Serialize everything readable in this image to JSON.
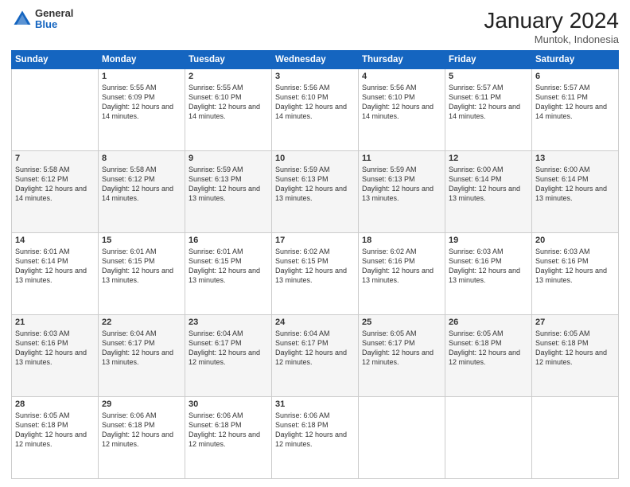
{
  "header": {
    "logo": {
      "line1": "General",
      "line2": "Blue"
    },
    "title": "January 2024",
    "subtitle": "Muntok, Indonesia"
  },
  "days_of_week": [
    "Sunday",
    "Monday",
    "Tuesday",
    "Wednesday",
    "Thursday",
    "Friday",
    "Saturday"
  ],
  "weeks": [
    [
      {
        "day": "",
        "info": ""
      },
      {
        "day": "1",
        "info": "Sunrise: 5:55 AM\nSunset: 6:09 PM\nDaylight: 12 hours\nand 14 minutes."
      },
      {
        "day": "2",
        "info": "Sunrise: 5:55 AM\nSunset: 6:10 PM\nDaylight: 12 hours\nand 14 minutes."
      },
      {
        "day": "3",
        "info": "Sunrise: 5:56 AM\nSunset: 6:10 PM\nDaylight: 12 hours\nand 14 minutes."
      },
      {
        "day": "4",
        "info": "Sunrise: 5:56 AM\nSunset: 6:10 PM\nDaylight: 12 hours\nand 14 minutes."
      },
      {
        "day": "5",
        "info": "Sunrise: 5:57 AM\nSunset: 6:11 PM\nDaylight: 12 hours\nand 14 minutes."
      },
      {
        "day": "6",
        "info": "Sunrise: 5:57 AM\nSunset: 6:11 PM\nDaylight: 12 hours\nand 14 minutes."
      }
    ],
    [
      {
        "day": "7",
        "info": "Sunrise: 5:58 AM\nSunset: 6:12 PM\nDaylight: 12 hours\nand 14 minutes."
      },
      {
        "day": "8",
        "info": "Sunrise: 5:58 AM\nSunset: 6:12 PM\nDaylight: 12 hours\nand 14 minutes."
      },
      {
        "day": "9",
        "info": "Sunrise: 5:59 AM\nSunset: 6:13 PM\nDaylight: 12 hours\nand 13 minutes."
      },
      {
        "day": "10",
        "info": "Sunrise: 5:59 AM\nSunset: 6:13 PM\nDaylight: 12 hours\nand 13 minutes."
      },
      {
        "day": "11",
        "info": "Sunrise: 5:59 AM\nSunset: 6:13 PM\nDaylight: 12 hours\nand 13 minutes."
      },
      {
        "day": "12",
        "info": "Sunrise: 6:00 AM\nSunset: 6:14 PM\nDaylight: 12 hours\nand 13 minutes."
      },
      {
        "day": "13",
        "info": "Sunrise: 6:00 AM\nSunset: 6:14 PM\nDaylight: 12 hours\nand 13 minutes."
      }
    ],
    [
      {
        "day": "14",
        "info": "Sunrise: 6:01 AM\nSunset: 6:14 PM\nDaylight: 12 hours\nand 13 minutes."
      },
      {
        "day": "15",
        "info": "Sunrise: 6:01 AM\nSunset: 6:15 PM\nDaylight: 12 hours\nand 13 minutes."
      },
      {
        "day": "16",
        "info": "Sunrise: 6:01 AM\nSunset: 6:15 PM\nDaylight: 12 hours\nand 13 minutes."
      },
      {
        "day": "17",
        "info": "Sunrise: 6:02 AM\nSunset: 6:15 PM\nDaylight: 12 hours\nand 13 minutes."
      },
      {
        "day": "18",
        "info": "Sunrise: 6:02 AM\nSunset: 6:16 PM\nDaylight: 12 hours\nand 13 minutes."
      },
      {
        "day": "19",
        "info": "Sunrise: 6:03 AM\nSunset: 6:16 PM\nDaylight: 12 hours\nand 13 minutes."
      },
      {
        "day": "20",
        "info": "Sunrise: 6:03 AM\nSunset: 6:16 PM\nDaylight: 12 hours\nand 13 minutes."
      }
    ],
    [
      {
        "day": "21",
        "info": "Sunrise: 6:03 AM\nSunset: 6:16 PM\nDaylight: 12 hours\nand 13 minutes."
      },
      {
        "day": "22",
        "info": "Sunrise: 6:04 AM\nSunset: 6:17 PM\nDaylight: 12 hours\nand 13 minutes."
      },
      {
        "day": "23",
        "info": "Sunrise: 6:04 AM\nSunset: 6:17 PM\nDaylight: 12 hours\nand 12 minutes."
      },
      {
        "day": "24",
        "info": "Sunrise: 6:04 AM\nSunset: 6:17 PM\nDaylight: 12 hours\nand 12 minutes."
      },
      {
        "day": "25",
        "info": "Sunrise: 6:05 AM\nSunset: 6:17 PM\nDaylight: 12 hours\nand 12 minutes."
      },
      {
        "day": "26",
        "info": "Sunrise: 6:05 AM\nSunset: 6:18 PM\nDaylight: 12 hours\nand 12 minutes."
      },
      {
        "day": "27",
        "info": "Sunrise: 6:05 AM\nSunset: 6:18 PM\nDaylight: 12 hours\nand 12 minutes."
      }
    ],
    [
      {
        "day": "28",
        "info": "Sunrise: 6:05 AM\nSunset: 6:18 PM\nDaylight: 12 hours\nand 12 minutes."
      },
      {
        "day": "29",
        "info": "Sunrise: 6:06 AM\nSunset: 6:18 PM\nDaylight: 12 hours\nand 12 minutes."
      },
      {
        "day": "30",
        "info": "Sunrise: 6:06 AM\nSunset: 6:18 PM\nDaylight: 12 hours\nand 12 minutes."
      },
      {
        "day": "31",
        "info": "Sunrise: 6:06 AM\nSunset: 6:18 PM\nDaylight: 12 hours\nand 12 minutes."
      },
      {
        "day": "",
        "info": ""
      },
      {
        "day": "",
        "info": ""
      },
      {
        "day": "",
        "info": ""
      }
    ]
  ]
}
